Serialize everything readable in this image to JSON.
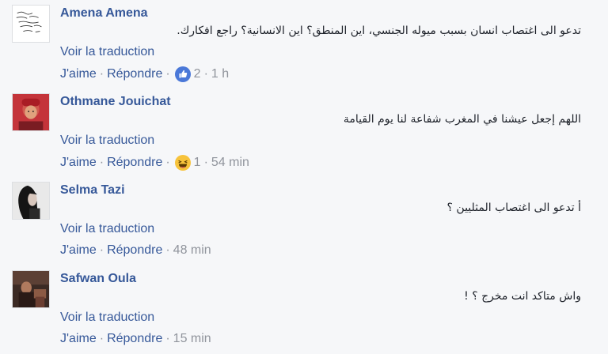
{
  "comments": [
    {
      "name": "Amena Amena",
      "text": "تدعو الى اغتصاب انسان بسبب ميوله الجنسي، اين المنطق؟ اين الانسانية؟ راجع افكارك.",
      "translate": "Voir la traduction",
      "like": "J'aime",
      "reply": "Répondre",
      "reaction_icon": "like-icon",
      "reaction_count": "2",
      "time": "1 h"
    },
    {
      "name": "Othmane Jouichat",
      "text": "اللهم إجعل عيشنا في المغرب شفاعة لنا يوم القيامة",
      "translate": "Voir la traduction",
      "like": "J'aime",
      "reply": "Répondre",
      "reaction_icon": "haha-icon",
      "reaction_count": "1",
      "time": "54 min"
    },
    {
      "name": "Selma Tazi",
      "text": "أ تدعو الى اغتصاب المثليين ؟",
      "translate": "Voir la traduction",
      "like": "J'aime",
      "reply": "Répondre",
      "time": "48 min"
    },
    {
      "name": "Safwan Oula",
      "text": "واش متاكد انت مخرج ؟ !",
      "translate": "Voir la traduction",
      "like": "J'aime",
      "reply": "Répondre",
      "time": "15 min"
    }
  ],
  "colors": {
    "link": "#365899",
    "meta": "#90949c",
    "text": "#1d2129",
    "background": "#f6f7f9"
  }
}
